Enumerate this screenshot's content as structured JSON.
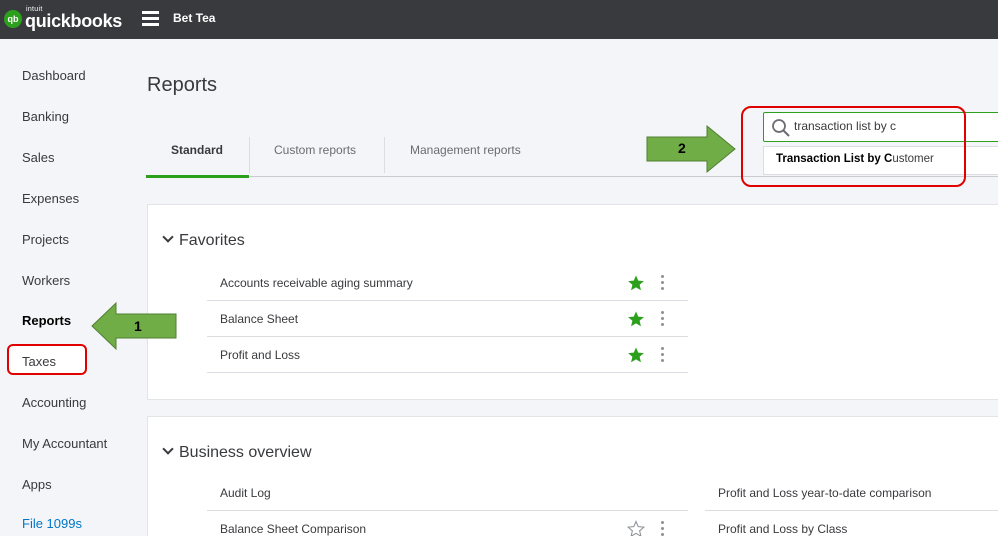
{
  "brand": {
    "badge": "qb",
    "intuit": "intuit",
    "name": "quickbooks"
  },
  "company_name": "Bet Tea",
  "sidebar": {
    "items": [
      {
        "label": "Dashboard"
      },
      {
        "label": "Banking"
      },
      {
        "label": "Sales"
      },
      {
        "label": "Expenses"
      },
      {
        "label": "Projects"
      },
      {
        "label": "Workers"
      },
      {
        "label": "Reports"
      },
      {
        "label": "Taxes"
      },
      {
        "label": "Accounting"
      },
      {
        "label": "My Accountant"
      },
      {
        "label": "Apps"
      },
      {
        "label": "File 1099s"
      }
    ]
  },
  "page_title": "Reports",
  "tabs": [
    {
      "label": "Standard"
    },
    {
      "label": "Custom reports"
    },
    {
      "label": "Management reports"
    }
  ],
  "search": {
    "value": "transaction list by c",
    "suggestion_bold": "Transaction List by C",
    "suggestion_rest": "ustomer"
  },
  "favorites": {
    "title": "Favorites",
    "items": [
      {
        "label": "Accounts receivable aging summary"
      },
      {
        "label": "Balance Sheet"
      },
      {
        "label": "Profit and Loss"
      }
    ]
  },
  "business_overview": {
    "title": "Business overview",
    "left": [
      {
        "label": "Audit Log"
      },
      {
        "label": "Balance Sheet Comparison"
      }
    ],
    "right": [
      {
        "label": "Profit and Loss year-to-date comparison"
      },
      {
        "label": "Profit and Loss by Class"
      }
    ]
  },
  "annotations": {
    "step1": "1",
    "step2": "2",
    "arrow_color": "#70ad47",
    "highlight_color": "#e00000"
  },
  "colors": {
    "accent": "#2ca01c",
    "topbar": "#393a3d",
    "link": "#0077c5"
  }
}
